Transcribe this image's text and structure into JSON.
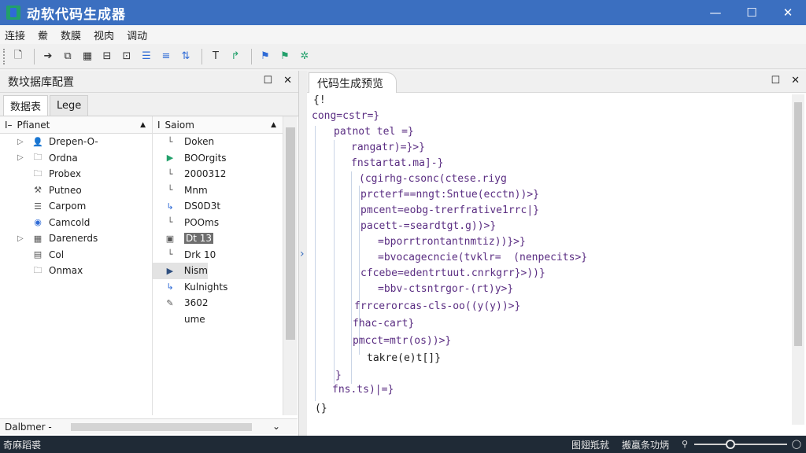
{
  "window": {
    "title": "动软代码生成器",
    "minimize": "—",
    "maximize": "☐",
    "close": "✕"
  },
  "menu": [
    "连接",
    "鮝",
    "数膜",
    "视肉",
    "调动"
  ],
  "left_panel": {
    "title": "数坟据库配置",
    "tabs": [
      "数据表",
      "Lege"
    ],
    "col_a_header": "Pfianet",
    "col_b_header": "Saiom",
    "tree": [
      {
        "label": "Drepen-O-",
        "expandable": true,
        "icon": "user-icon"
      },
      {
        "label": "Ordna",
        "expandable": true,
        "icon": "folder-icon"
      },
      {
        "label": "Probex",
        "expandable": false,
        "icon": "folder-icon"
      },
      {
        "label": "Putneo",
        "expandable": false,
        "icon": "hammer-icon"
      },
      {
        "label": "Carpom",
        "expandable": false,
        "icon": "list-icon"
      },
      {
        "label": "Camcold",
        "expandable": false,
        "icon": "globe-icon"
      },
      {
        "label": "Darenerds",
        "expandable": true,
        "icon": "grid-icon"
      },
      {
        "label": "Col",
        "expandable": false,
        "icon": "table-icon"
      },
      {
        "label": "Onmax",
        "expandable": false,
        "icon": "folder-icon"
      }
    ],
    "fields": [
      {
        "label": "Doken",
        "icon": "field-icon"
      },
      {
        "label": "BOOrgits",
        "icon": "play-icon"
      },
      {
        "label": "2000312",
        "icon": "field-icon"
      },
      {
        "label": "Mnm",
        "icon": "field-icon"
      },
      {
        "label": "DS0D3t",
        "icon": "link-icon"
      },
      {
        "label": "POOms",
        "icon": "field-icon"
      },
      {
        "label": "Dt 13",
        "icon": "box-icon"
      },
      {
        "label": "Drk 10",
        "icon": "field-icon"
      },
      {
        "label": "Nism",
        "icon": "play-icon"
      },
      {
        "label": "Kulnights",
        "icon": "link-icon"
      },
      {
        "label": "3602",
        "icon": "pen-icon"
      },
      {
        "label": "ume",
        "icon": "none"
      }
    ],
    "hscroll_label": "Dalbmer -"
  },
  "right_panel": {
    "title": "代码生成预览",
    "code": [
      "{!",
      "cong=cstr=}",
      "patnot tel =}",
      "rangatr)=}>}",
      "fnstartat.ma]-}",
      "(cgirhg-csonc(ctese.riyg",
      "prcterf==nngt:Sntue(ecctn))>}",
      "pmcent=eobg-trerfrative1rrc|}",
      "pacett-=seardtgt.g))>}",
      "=bporrtrontantnmtiz))}>}",
      "=bvocagecncie(tvklr=  (nenpecits>}",
      "cfcebe=edentrtuut.cnrkgrr}>))}",
      "=bbv-ctsntrgor-(rt)y>}",
      "frrcerorcas-cls-oo((y(y))>}",
      "fhac-cart}",
      "pmcct=mtr(os))>}",
      "takre(e)t[]}",
      "}",
      "fns.ts)|=}",
      "(}"
    ]
  },
  "status": {
    "left": "奇麻蹈裘",
    "right1": "图翅羝就",
    "right2": "搬蠃条功炳"
  },
  "colors": {
    "titlebar": "#3b6fc0",
    "statusbar": "#1f2a36",
    "code_purple": "#5a2d82",
    "code_green": "#0a7a3a"
  }
}
